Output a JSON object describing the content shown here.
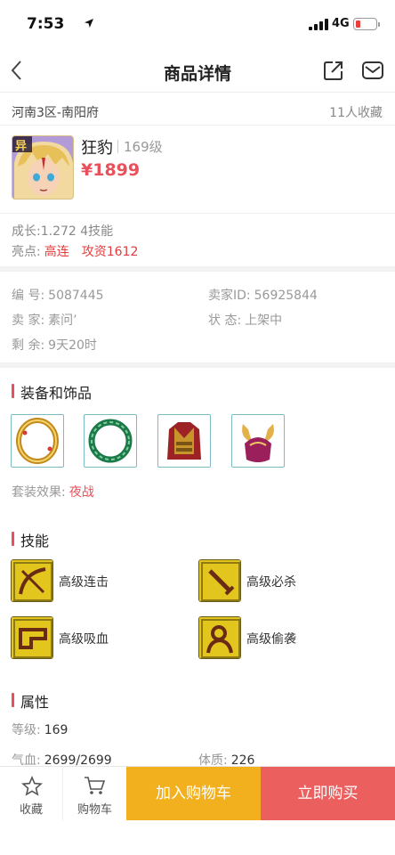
{
  "status_bar": {
    "time": "7:53",
    "network": "4G"
  },
  "header": {
    "title": "商品详情"
  },
  "listing": {
    "server": "河南3区-南阳府",
    "favorites": "11人收藏"
  },
  "role": {
    "avatar_badge": "异",
    "name": "狂豹",
    "level": "169级",
    "price": "¥1899",
    "growth": "成长:1.272 4技能",
    "highlight_label": "亮点:",
    "highlights": [
      "高连",
      "攻资1612"
    ]
  },
  "info": {
    "id_label": "编 号:",
    "id_value": "5087445",
    "seller_id_label": "卖家ID:",
    "seller_id_value": "56925844",
    "seller_label": "卖 家:",
    "seller_value": "素问’",
    "status_label": "状 态:",
    "status_value": "上架中",
    "remain_label": "剩 余:",
    "remain_value": "9天20时"
  },
  "equipment": {
    "title": "装备和饰品",
    "items": [
      {
        "icon": "gold-ring-icon"
      },
      {
        "icon": "jade-ring-icon"
      },
      {
        "icon": "armor-icon"
      },
      {
        "icon": "helmet-icon"
      }
    ],
    "suit_label": "套装效果:",
    "suit_value": "夜战"
  },
  "skills": {
    "title": "技能",
    "items": [
      {
        "label": "高级连击",
        "icon": "combo-skill-icon"
      },
      {
        "label": "高级必杀",
        "icon": "critical-skill-icon"
      },
      {
        "label": "高级吸血",
        "icon": "lifesteal-skill-icon"
      },
      {
        "label": "高级偷袭",
        "icon": "ambush-skill-icon"
      }
    ]
  },
  "attributes": {
    "title": "属性",
    "level_label": "等级:",
    "level_value": "169",
    "hp_label": "气血:",
    "hp_value": "2699/2699",
    "con_label": "体质:",
    "con_value": "226"
  },
  "bottom_bar": {
    "fav_label": "收藏",
    "cart_label": "购物车",
    "add_cart_label": "加入购物车",
    "buy_label": "立即购买"
  },
  "colors": {
    "price": "#e8505b",
    "accent": "#e8505b",
    "add_cart": "#f2b01e",
    "buy": "#ec5f5f"
  }
}
